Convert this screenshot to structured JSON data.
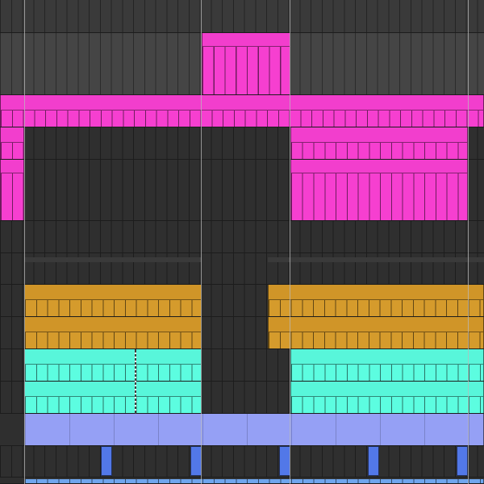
{
  "arrangement": {
    "name": "arrangement-view"
  },
  "colors": {
    "background": "#2f2f2f",
    "empty_lane": "#2f2f2f",
    "empty_lane_light": "#454545",
    "magenta": "#f63fd0",
    "magenta_head": "#f23ecd",
    "gold": "#d59b2c",
    "gold_head": "#d09528",
    "cyan": "#5cfde0",
    "cyan_head": "#58f6da",
    "lavender": "#95a0f5",
    "note_blue": "#5278e8",
    "bottom_blue": "#6fa6ee",
    "marker": "#b9b9b9"
  },
  "tracks": [
    {
      "id": "track-1",
      "label": "",
      "clips": []
    },
    {
      "id": "track-2",
      "label": "",
      "clips": [
        "magenta"
      ]
    },
    {
      "id": "track-3",
      "label": "",
      "clips": [
        "magenta"
      ]
    },
    {
      "id": "track-4",
      "label": "",
      "clips": [
        "magenta"
      ]
    },
    {
      "id": "track-5",
      "label": "",
      "clips": [
        "magenta"
      ]
    },
    {
      "id": "track-6",
      "label": "",
      "clips": []
    },
    {
      "id": "track-7",
      "label": "",
      "clips": []
    },
    {
      "id": "track-8",
      "label": "",
      "clips": [
        "gold"
      ]
    },
    {
      "id": "track-9",
      "label": "",
      "clips": [
        "gold"
      ]
    },
    {
      "id": "track-10",
      "label": "",
      "clips": [
        "cyan"
      ]
    },
    {
      "id": "track-11",
      "label": "",
      "clips": [
        "cyan"
      ]
    },
    {
      "id": "track-12",
      "label": "",
      "clips": [
        "lavender"
      ]
    },
    {
      "id": "track-13",
      "label": "",
      "clips": [
        "blue-notes"
      ]
    },
    {
      "id": "track-14",
      "label": "",
      "clips": [
        "blue"
      ]
    }
  ]
}
